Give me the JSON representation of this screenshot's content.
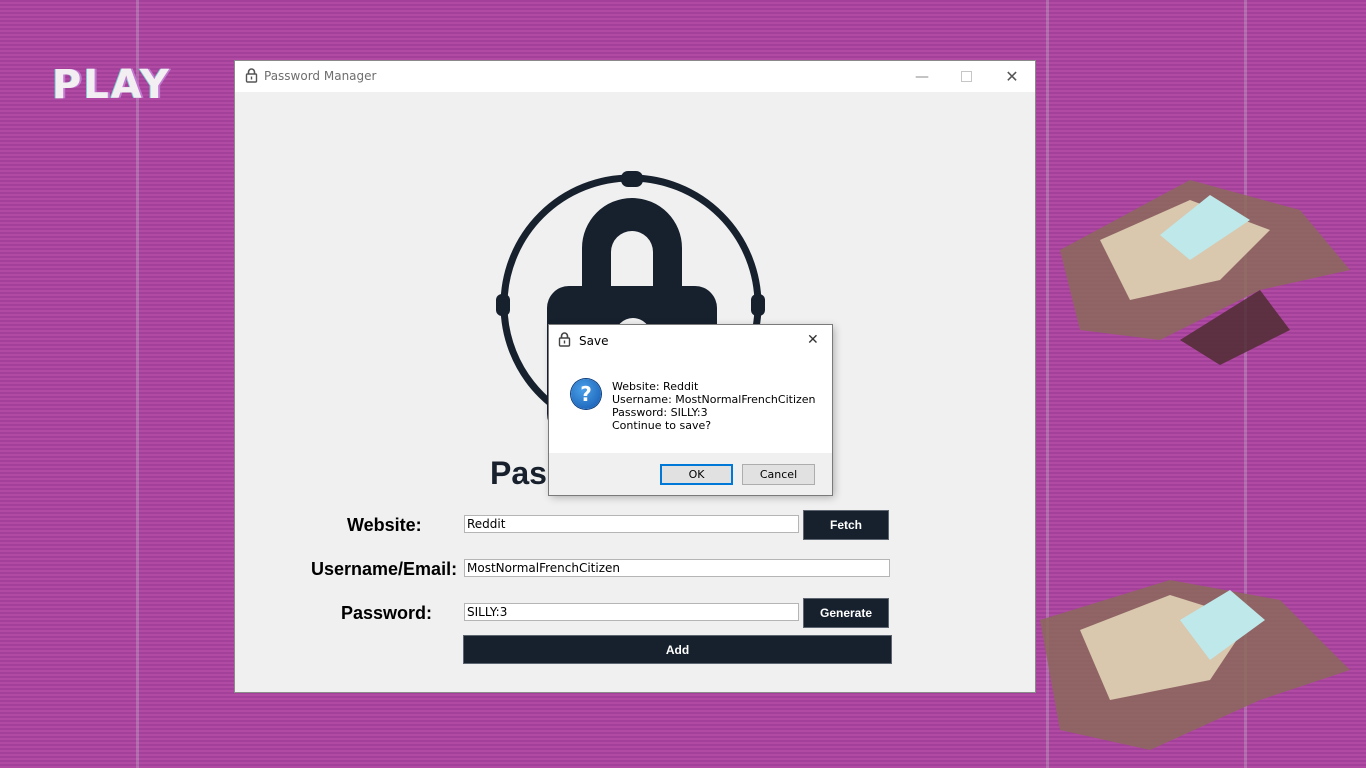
{
  "wallpaper": {
    "overlay_text": "PLAY",
    "colors": {
      "background": "#b04aa2",
      "accent": "#f2eef2"
    }
  },
  "app": {
    "title": "Password Manager",
    "heading_visible": "Pass",
    "fields": {
      "website_label": "Website:",
      "website_value": "Reddit",
      "username_label": "Username/Email:",
      "username_value": "MostNormalFrenchCitizen",
      "password_label": "Password:",
      "password_value": "SILLY:3"
    },
    "buttons": {
      "fetch": "Fetch",
      "generate": "Generate",
      "add": "Add"
    },
    "colors": {
      "dark": "#17212e",
      "window_bg": "#f0f0f0"
    }
  },
  "dialog": {
    "title": "Save",
    "message_lines": [
      "Website: Reddit",
      "Username: MostNormalFrenchCitizen",
      "Password: SILLY:3",
      "Continue to save?"
    ],
    "ok_label": "OK",
    "cancel_label": "Cancel",
    "icon": "question-icon"
  }
}
